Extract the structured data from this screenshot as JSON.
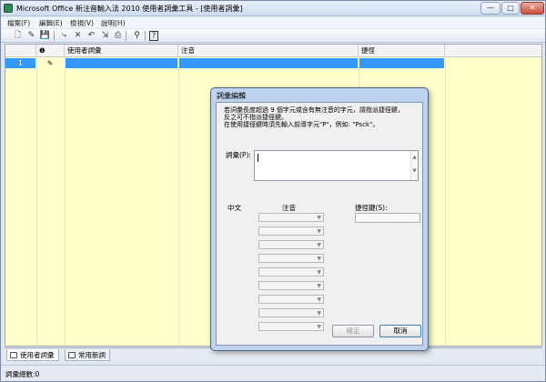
{
  "window": {
    "title": "Microsoft Office 新注音輸入法 2010 使用者詞彙工具 - [使用者詞彙]"
  },
  "caption_buttons": {
    "minimize": "—",
    "maximize": "□",
    "close": "✕"
  },
  "menu": [
    "檔案(F)",
    "編輯(E)",
    "檢視(V)",
    "說明(H)"
  ],
  "toolbar": {
    "icons": [
      "new-icon",
      "open-icon",
      "save-icon",
      "add-word-icon",
      "delete-icon",
      "undo-icon",
      "import-icon",
      "print-icon",
      "find-icon",
      "help-icon"
    ],
    "glyphs": [
      "🗋",
      "✎",
      "💾",
      "⤷",
      "✕",
      "↶",
      "⇲",
      "⎙",
      "⚲",
      "?"
    ]
  },
  "grid": {
    "columns": [
      "",
      "❶",
      "使用者詞彙",
      "注音",
      "捷徑"
    ],
    "rows": [
      {
        "num": "1",
        "icon": "✎",
        "word": "",
        "zhuyin": "",
        "shortcut": ""
      }
    ]
  },
  "tabs": [
    {
      "label": "使用者詞彙",
      "active": true
    },
    {
      "label": "常用新詞",
      "active": false
    }
  ],
  "status": {
    "text": "詞彙總數:0"
  },
  "dialog": {
    "title": "詞彙編輯",
    "notes": [
      "若詞彙長度超過 9 個字元或含有無注音的字元，請指派捷徑鍵，",
      "反之可不指派捷徑鍵。",
      "在使用捷徑鍵時須先輸入前導字元\"P\"，例如: \"Psck\"。"
    ],
    "word_label": "詞彙(P):",
    "word_value": "",
    "chinese_label": "中文",
    "zhuyin_label": "注音",
    "shortcut_label": "捷徑鍵(S):",
    "shortcut_value": "",
    "ok_label": "確定",
    "cancel_label": "取消"
  }
}
